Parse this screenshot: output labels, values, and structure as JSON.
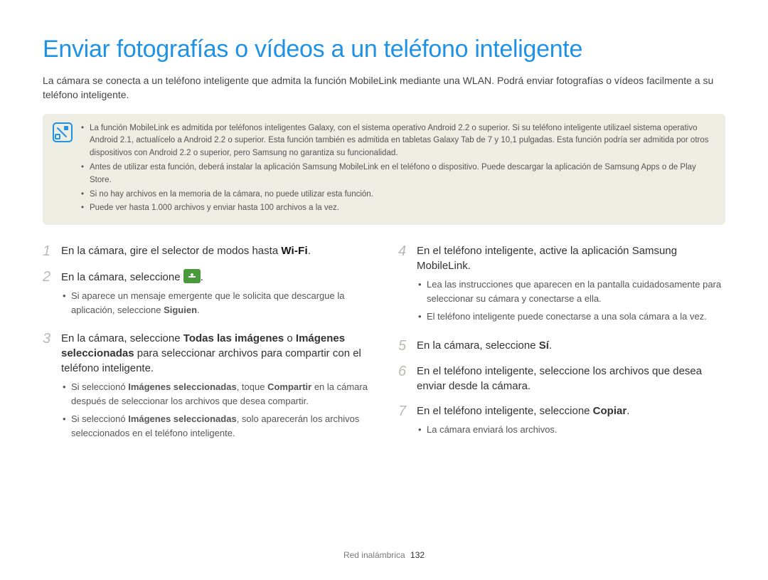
{
  "title": "Enviar fotografías o vídeos a un teléfono inteligente",
  "intro": "La cámara se conecta a un teléfono inteligente que admita la función MobileLink mediante una WLAN. Podrá enviar fotografías o vídeos facilmente a su teléfono inteligente.",
  "notes": [
    "La función MobileLink es admitida por teléfonos inteligentes Galaxy, con el sistema operativo Android 2.2 o superior. Si su teléfono inteligente utilizael sistema operativo Android 2.1, actualícelo a Android 2.2 o superior. Esta función también es admitida en tabletas Galaxy Tab de 7 y 10,1 pulgadas. Esta función podría ser admitida por otros dispositivos con Android 2.2 o superior, pero Samsung no garantiza su funcionalidad.",
    "Antes de utilizar esta función, deberá instalar la aplicación Samsung MobileLink en el teléfono o dispositivo. Puede descargar la aplicación de Samsung Apps o de Play Store.",
    "Si no hay archivos en la memoria de la cámara, no puede utilizar esta función.",
    "Puede ver hasta 1.000 archivos y enviar hasta 100 archivos a la vez."
  ],
  "steps": {
    "s1_pre": "En la cámara, gire el selector de modos hasta ",
    "s1_badge": "Wi-Fi",
    "s1_post": ".",
    "s2_pre": "En la cámara, seleccione ",
    "s2_post": ".",
    "s2_sub": "Si aparece un mensaje emergente que le solicita que descargue la aplicación, seleccione <b>Siguien</b>.",
    "s3_html": "En la cámara, seleccione <b>Todas las imágenes</b> o <b>Imágenes seleccionadas</b> para seleccionar archivos para compartir con el teléfono inteligente.",
    "s3_sub1": "Si seleccionó <b>Imágenes seleccionadas</b>, toque <b>Compartir</b> en la cámara después de seleccionar los archivos que desea compartir.",
    "s3_sub2": "Si seleccionó <b>Imágenes seleccionadas</b>, solo aparecerán los archivos seleccionados en el teléfono inteligente.",
    "s4": "En el teléfono inteligente, active la aplicación Samsung MobileLink.",
    "s4_sub1": "Lea las instrucciones que aparecen en la pantalla cuidadosamente para seleccionar su cámara y conectarse a ella.",
    "s4_sub2": "El teléfono inteligente puede conectarse a una sola cámara a la vez.",
    "s5_html": "En la cámara, seleccione <b>Sí</b>.",
    "s6": "En el teléfono inteligente, seleccione los archivos que desea enviar desde la cámara.",
    "s7_html": "En el teléfono inteligente, seleccione <b>Copiar</b>.",
    "s7_sub": "La cámara enviará los archivos."
  },
  "footer": {
    "label": "Red inalámbrica",
    "page": "132"
  }
}
